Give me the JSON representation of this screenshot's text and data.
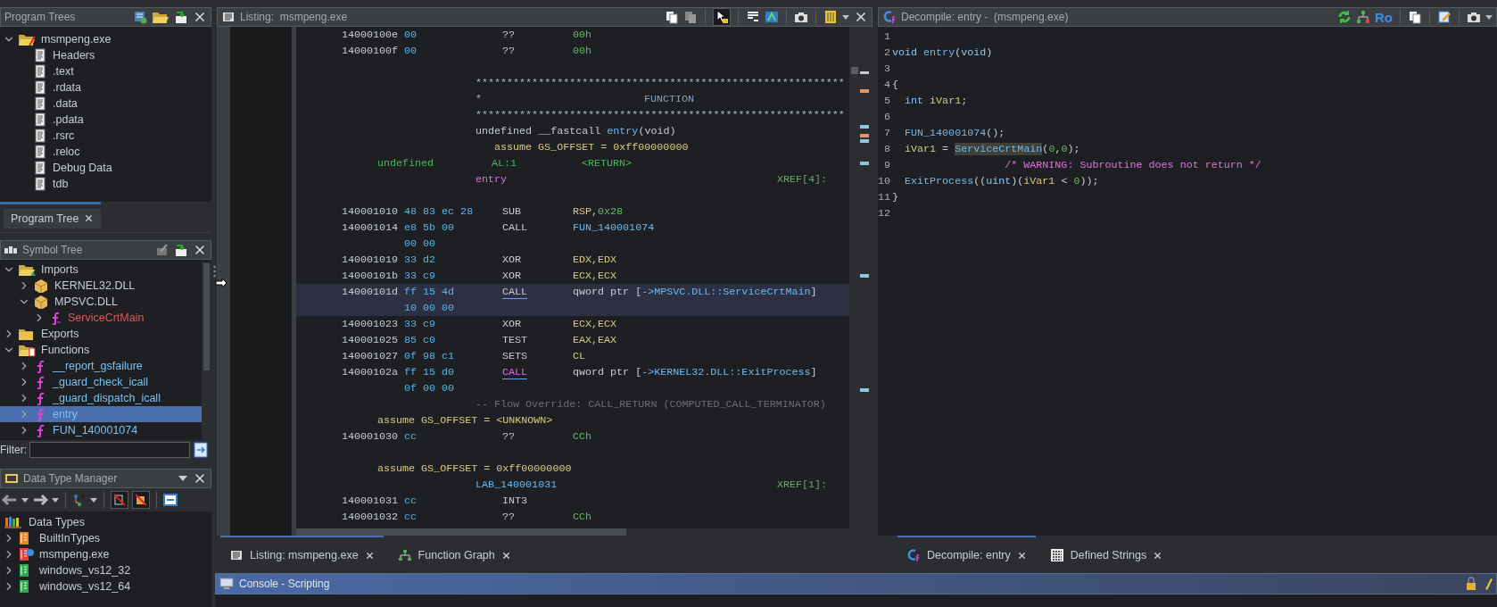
{
  "program_trees": {
    "title": "Program Trees",
    "tree": [
      {
        "label": "msmpeng.exe",
        "kind": "program",
        "expanded": true,
        "children": [
          {
            "label": "Headers",
            "kind": "fragment"
          },
          {
            "label": ".text",
            "kind": "fragment"
          },
          {
            "label": ".rdata",
            "kind": "fragment"
          },
          {
            "label": ".data",
            "kind": "fragment"
          },
          {
            "label": ".pdata",
            "kind": "fragment"
          },
          {
            "label": ".rsrc",
            "kind": "fragment"
          },
          {
            "label": ".reloc",
            "kind": "fragment"
          },
          {
            "label": "Debug Data",
            "kind": "fragment"
          },
          {
            "label": "tdb",
            "kind": "fragment"
          }
        ]
      }
    ],
    "tabs": [
      {
        "label": "Program Tree",
        "selected": true
      }
    ]
  },
  "symbol_tree": {
    "title": "Symbol Tree",
    "tree": [
      {
        "label": "Imports",
        "kind": "imports",
        "expanded": true,
        "selected": false,
        "children": [
          {
            "label": "KERNEL32.DLL",
            "kind": "library",
            "expanded": false,
            "selected": false
          },
          {
            "label": "MPSVC.DLL",
            "kind": "library",
            "expanded": true,
            "selected": false,
            "children": [
              {
                "label": "ServiceCrtMain",
                "kind": "external",
                "expanded": false,
                "selected": false
              }
            ]
          }
        ]
      },
      {
        "label": "Exports",
        "kind": "exports",
        "expanded": false,
        "selected": false
      },
      {
        "label": "Functions",
        "kind": "functions",
        "expanded": true,
        "selected": false,
        "children": [
          {
            "label": "__report_gsfailure",
            "kind": "function",
            "expanded": false,
            "selected": false
          },
          {
            "label": "_guard_check_icall",
            "kind": "function",
            "expanded": false,
            "selected": false
          },
          {
            "label": "_guard_dispatch_icall",
            "kind": "function",
            "expanded": false,
            "selected": false
          },
          {
            "label": "entry",
            "kind": "function",
            "expanded": false,
            "selected": true
          },
          {
            "label": "FUN_140001074",
            "kind": "function",
            "expanded": false,
            "selected": false
          }
        ]
      }
    ],
    "filter": {
      "label": "Filter:"
    }
  },
  "data_type_manager": {
    "title": "Data Type Manager",
    "tree": [
      {
        "label": "Data Types",
        "kind": "root",
        "children": [
          {
            "label": "BuiltInTypes",
            "kind": "builtin",
            "expanded": false
          },
          {
            "label": "msmpeng.exe",
            "kind": "program_types",
            "expanded": false
          },
          {
            "label": "windows_vs12_32",
            "kind": "archive",
            "expanded": false
          },
          {
            "label": "windows_vs12_64",
            "kind": "archive",
            "expanded": false
          }
        ]
      }
    ]
  },
  "listing": {
    "title": "Listing:  msmpeng.exe",
    "lines": [
      {
        "kind": "code",
        "address": "14000100e",
        "bytes": "00",
        "mnemonic": "??",
        "operand": [
          {
            "text": "00h",
            "kind": "number"
          }
        ],
        "selected": false
      },
      {
        "kind": "code",
        "address": "14000100f",
        "bytes": "00",
        "mnemonic": "??",
        "operand": [
          {
            "text": "00h",
            "kind": "number"
          }
        ],
        "selected": false
      },
      {
        "kind": "blank"
      },
      {
        "kind": "stars",
        "text": "***********************************************************"
      },
      {
        "kind": "banner",
        "text": "*",
        "title": "FUNCTION"
      },
      {
        "kind": "stars",
        "text": "***********************************************************"
      },
      {
        "kind": "signature",
        "parts": [
          {
            "text": "undefined __fastcall ",
            "kind": "plain"
          },
          {
            "text": "entry",
            "kind": "ref"
          },
          {
            "text": "(void)",
            "kind": "plain"
          }
        ]
      },
      {
        "kind": "function_assume",
        "text": "assume GS_OFFSET = 0xff00000000"
      },
      {
        "kind": "param",
        "type": "undefined",
        "storage": "AL:1",
        "name": "<RETURN>"
      },
      {
        "kind": "label",
        "label": "entry",
        "is_function": true,
        "xref": "XREF[4]:"
      },
      {
        "kind": "blank"
      },
      {
        "kind": "code",
        "address": "140001010",
        "bytes": "48 83 ec 28",
        "mnemonic": "SUB",
        "operand": [
          {
            "text": "RSP",
            "kind": "register"
          },
          {
            "text": ",",
            "kind": "plain"
          },
          {
            "text": "0x28",
            "kind": "number"
          }
        ],
        "selected": false
      },
      {
        "kind": "code",
        "address": "140001014",
        "bytes": "e8 5b 00",
        "mnemonic": "CALL",
        "operand": [
          {
            "text": "FUN_140001074",
            "kind": "ref"
          }
        ],
        "selected": false
      },
      {
        "kind": "bytes",
        "bytes": "00 00",
        "selected": false
      },
      {
        "kind": "code",
        "address": "140001019",
        "bytes": "33 d2",
        "mnemonic": "XOR",
        "operand": [
          {
            "text": "EDX,EDX",
            "kind": "register"
          }
        ],
        "selected": false
      },
      {
        "kind": "code",
        "address": "14000101b",
        "bytes": "33 c9",
        "mnemonic": "XOR",
        "operand": [
          {
            "text": "ECX,ECX",
            "kind": "register"
          }
        ],
        "selected": false
      },
      {
        "kind": "code",
        "address": "14000101d",
        "bytes": "ff 15 4d",
        "mnemonic": "CALL",
        "reference": true,
        "operand": [
          {
            "text": "qword ptr [",
            "kind": "plain"
          },
          {
            "text": "->MPSVC.DLL::ServiceCrtMain",
            "kind": "ref"
          },
          {
            "text": "]",
            "kind": "plain"
          }
        ],
        "selected": true
      },
      {
        "kind": "bytes",
        "bytes": "10 00 00",
        "selected": true
      },
      {
        "kind": "code",
        "address": "140001023",
        "bytes": "33 c9",
        "mnemonic": "XOR",
        "operand": [
          {
            "text": "ECX,ECX",
            "kind": "register"
          }
        ],
        "selected": false
      },
      {
        "kind": "code",
        "address": "140001025",
        "bytes": "85 c0",
        "mnemonic": "TEST",
        "operand": [
          {
            "text": "EAX,EAX",
            "kind": "register"
          }
        ],
        "selected": false
      },
      {
        "kind": "code",
        "address": "140001027",
        "bytes": "0f 98 c1",
        "mnemonic": "SETS",
        "operand": [
          {
            "text": "CL",
            "kind": "register"
          }
        ],
        "selected": false
      },
      {
        "kind": "code",
        "address": "14000102a",
        "bytes": "ff 15 d0",
        "mnemonic": "CALL",
        "reference": true,
        "terminator": true,
        "operand": [
          {
            "text": "qword ptr [",
            "kind": "plain"
          },
          {
            "text": "->KERNEL32.DLL::ExitProcess",
            "kind": "ref"
          },
          {
            "text": "]",
            "kind": "plain"
          }
        ],
        "selected": false
      },
      {
        "kind": "bytes",
        "bytes": "0f 00 00",
        "selected": false
      },
      {
        "kind": "flow",
        "text": "-- Flow Override: CALL_RETURN (COMPUTED_CALL_TERMINATOR)"
      },
      {
        "kind": "assume",
        "text": "assume GS_OFFSET = <UNKNOWN>"
      },
      {
        "kind": "code",
        "address": "140001030",
        "bytes": "cc",
        "mnemonic": "??",
        "operand": [
          {
            "text": "CCh",
            "kind": "number"
          }
        ],
        "selected": false
      },
      {
        "kind": "blank"
      },
      {
        "kind": "assume",
        "text": "assume GS_OFFSET = 0xff00000000"
      },
      {
        "kind": "label",
        "label": "LAB_140001031",
        "is_function": false,
        "xref": "XREF[1]:"
      },
      {
        "kind": "code",
        "address": "140001031",
        "bytes": "cc",
        "mnemonic": "INT3",
        "selected": false
      },
      {
        "kind": "code",
        "address": "140001032",
        "bytes": "cc",
        "mnemonic": "??",
        "operand": [
          {
            "text": "CCh",
            "kind": "number"
          }
        ],
        "selected": false
      }
    ]
  },
  "decompiler": {
    "title": "Decompile: entry -  (msmpeng.exe)",
    "toolbar_label": "Ro",
    "lines": [
      {
        "number": "1"
      },
      {
        "number": "2",
        "segments": [
          {
            "text": "void ",
            "kind": "type"
          },
          {
            "text": "entry",
            "kind": "function"
          },
          {
            "text": "(",
            "kind": "plain"
          },
          {
            "text": "void",
            "kind": "type"
          },
          {
            "text": ")",
            "kind": "plain"
          }
        ]
      },
      {
        "number": "3"
      },
      {
        "number": "4",
        "segments": [
          {
            "text": "{",
            "kind": "plain"
          }
        ]
      },
      {
        "number": "5",
        "segments": [
          {
            "text": "  int ",
            "kind": "type"
          },
          {
            "text": "iVar1",
            "kind": "var"
          },
          {
            "text": ";",
            "kind": "plain"
          }
        ]
      },
      {
        "number": "6"
      },
      {
        "number": "7",
        "segments": [
          {
            "text": "  FUN_140001074",
            "kind": "function"
          },
          {
            "text": "();",
            "kind": "plain"
          }
        ]
      },
      {
        "number": "8",
        "segments": [
          {
            "text": "  iVar1",
            "kind": "var"
          },
          {
            "text": " = ",
            "kind": "plain"
          },
          {
            "text": "ServiceCrtMain",
            "kind": "function",
            "highlight": true
          },
          {
            "text": "(",
            "kind": "plain"
          },
          {
            "text": "0",
            "kind": "number"
          },
          {
            "text": ",",
            "kind": "plain"
          },
          {
            "text": "0",
            "kind": "number"
          },
          {
            "text": ");",
            "kind": "plain"
          }
        ]
      },
      {
        "number": "9",
        "segments": [
          {
            "text": "                  /* WARNING: Subroutine does not return */",
            "kind": "comment"
          }
        ]
      },
      {
        "number": "10",
        "segments": [
          {
            "text": "  ExitProcess",
            "kind": "function"
          },
          {
            "text": "((",
            "kind": "plain"
          },
          {
            "text": "uint",
            "kind": "type"
          },
          {
            "text": ")(",
            "kind": "plain"
          },
          {
            "text": "iVar1",
            "kind": "var"
          },
          {
            "text": " < ",
            "kind": "plain"
          },
          {
            "text": "0",
            "kind": "number"
          },
          {
            "text": "));",
            "kind": "plain"
          }
        ]
      },
      {
        "number": "11",
        "segments": [
          {
            "text": "}",
            "kind": "plain"
          }
        ]
      },
      {
        "number": "12"
      }
    ]
  },
  "bottom_tabs": {
    "left": [
      {
        "label": "Listing: msmpeng.exe",
        "kind": "listing",
        "selected": true
      },
      {
        "label": "Function Graph",
        "kind": "graph",
        "selected": false
      }
    ],
    "right": [
      {
        "label": "Decompile: entry",
        "kind": "decompile",
        "selected": true
      },
      {
        "label": "Defined Strings",
        "kind": "strings",
        "selected": false
      }
    ]
  },
  "console": {
    "title": "Console - Scripting"
  }
}
